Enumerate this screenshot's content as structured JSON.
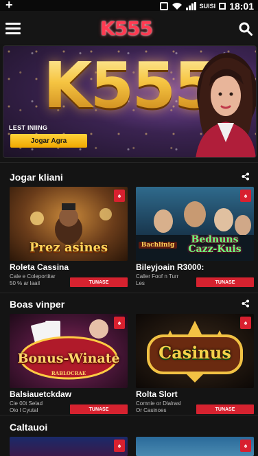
{
  "status_bar": {
    "carrier": "SUISI",
    "time": "18:01"
  },
  "app_bar": {
    "logo": "K555"
  },
  "hero": {
    "title": "K555",
    "subtitle": "LEST INIING",
    "cta_label": "Jogar Agra"
  },
  "sections": [
    {
      "title": "Jogar kliani",
      "cards": [
        {
          "thumb_text": "Prez asines",
          "title": "Roleta Cassina",
          "meta": [
            "Cale e Coleportitar",
            "50 % ar laail"
          ],
          "button": "TUNASE"
        },
        {
          "thumb_text": "Bednuns Cazz-Kuis",
          "thumb_small": "Bachlinig",
          "title": "Bileyjoain R3000:",
          "meta": [
            "Caller Foof n Turr",
            "Les"
          ],
          "button": "TUNASE"
        }
      ]
    },
    {
      "title": "Boas vinper",
      "cards": [
        {
          "thumb_text": "Bonus-Winate",
          "thumb_small": "RABLOCRAE",
          "title": "Balsiauetckdaw",
          "meta": [
            "Cie 00t Selad",
            "Oio l Cyutal"
          ],
          "button": "TUNASE"
        },
        {
          "thumb_text": "Casinus",
          "title": "Rolta Slort",
          "meta": [
            "Comnie or Dlalrasl",
            "Or Casinoes"
          ],
          "button": "TUNASE"
        }
      ]
    },
    {
      "title": "Caltauoi"
    }
  ],
  "colors": {
    "accent": "#d6222f",
    "cta": "#f6c542",
    "background": "#141414"
  }
}
